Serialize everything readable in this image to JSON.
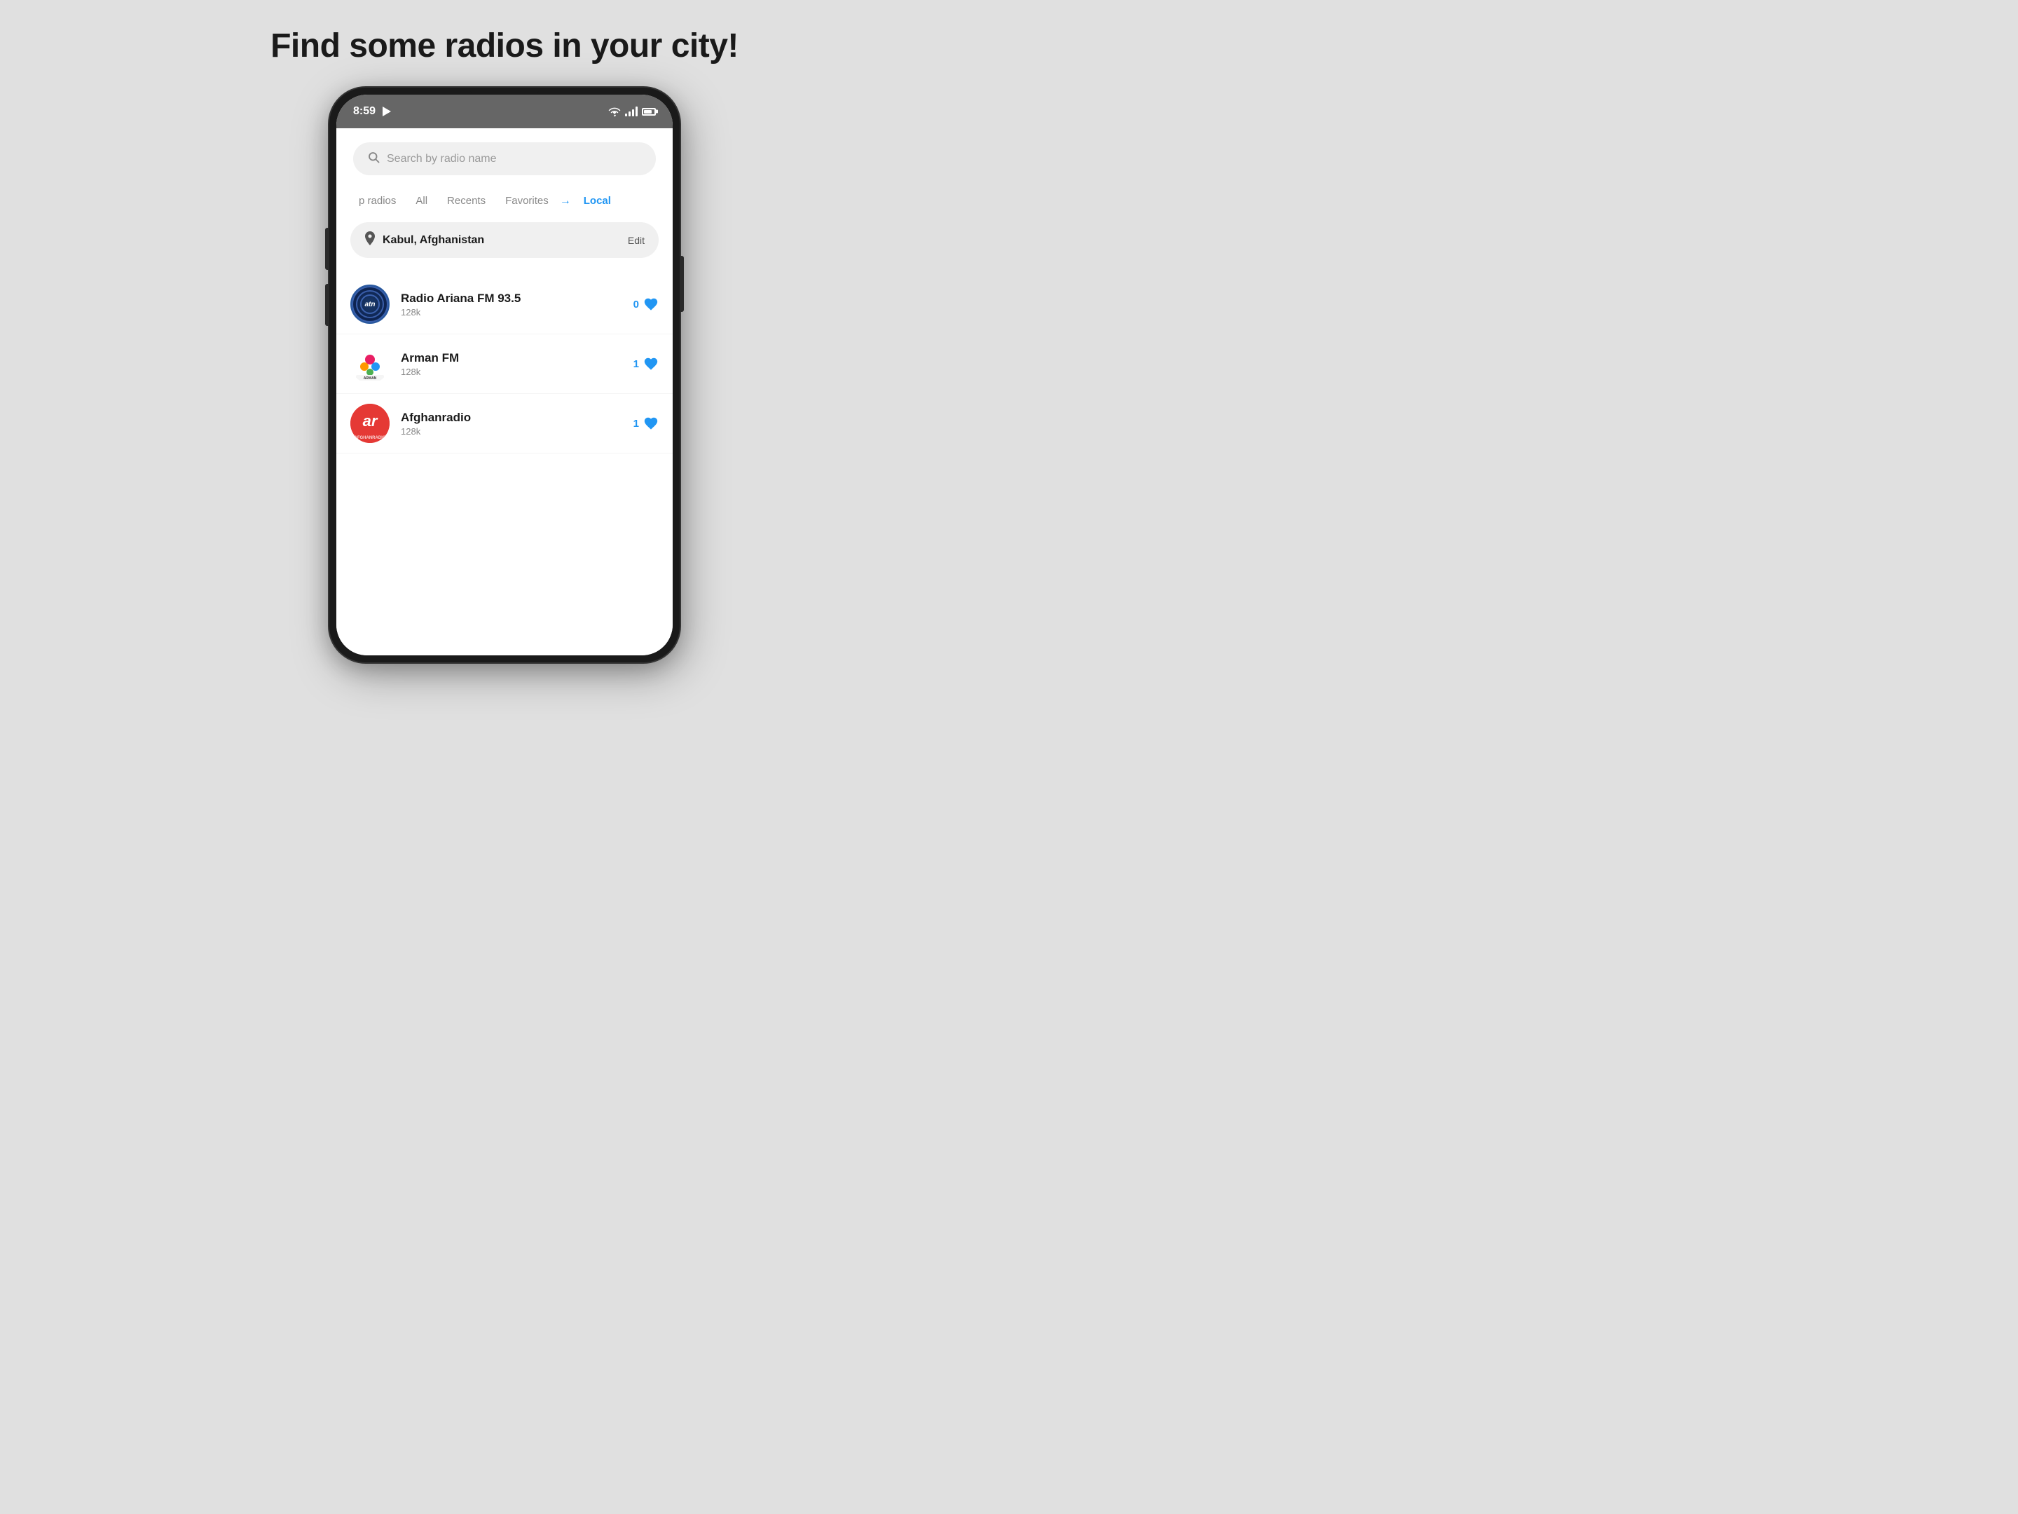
{
  "page": {
    "title": "Find some radios in your city!",
    "background_color": "#e0e0e0"
  },
  "status_bar": {
    "time": "8:59",
    "color": "#666666"
  },
  "search": {
    "placeholder": "Search by radio name"
  },
  "tabs": [
    {
      "label": "p radios",
      "active": false
    },
    {
      "label": "All",
      "active": false
    },
    {
      "label": "Recents",
      "active": false
    },
    {
      "label": "Favorites",
      "active": false
    },
    {
      "label": "Local",
      "active": true
    }
  ],
  "location": {
    "name": "Kabul, Afghanistan",
    "edit_label": "Edit"
  },
  "radios": [
    {
      "name": "Radio Ariana FM 93.5",
      "bitrate": "128k",
      "likes": "0",
      "logo_type": "ariana"
    },
    {
      "name": "Arman FM",
      "bitrate": "128k",
      "likes": "1",
      "logo_type": "arman"
    },
    {
      "name": "Afghanradio",
      "bitrate": "128k",
      "likes": "1",
      "logo_type": "afghan"
    }
  ]
}
